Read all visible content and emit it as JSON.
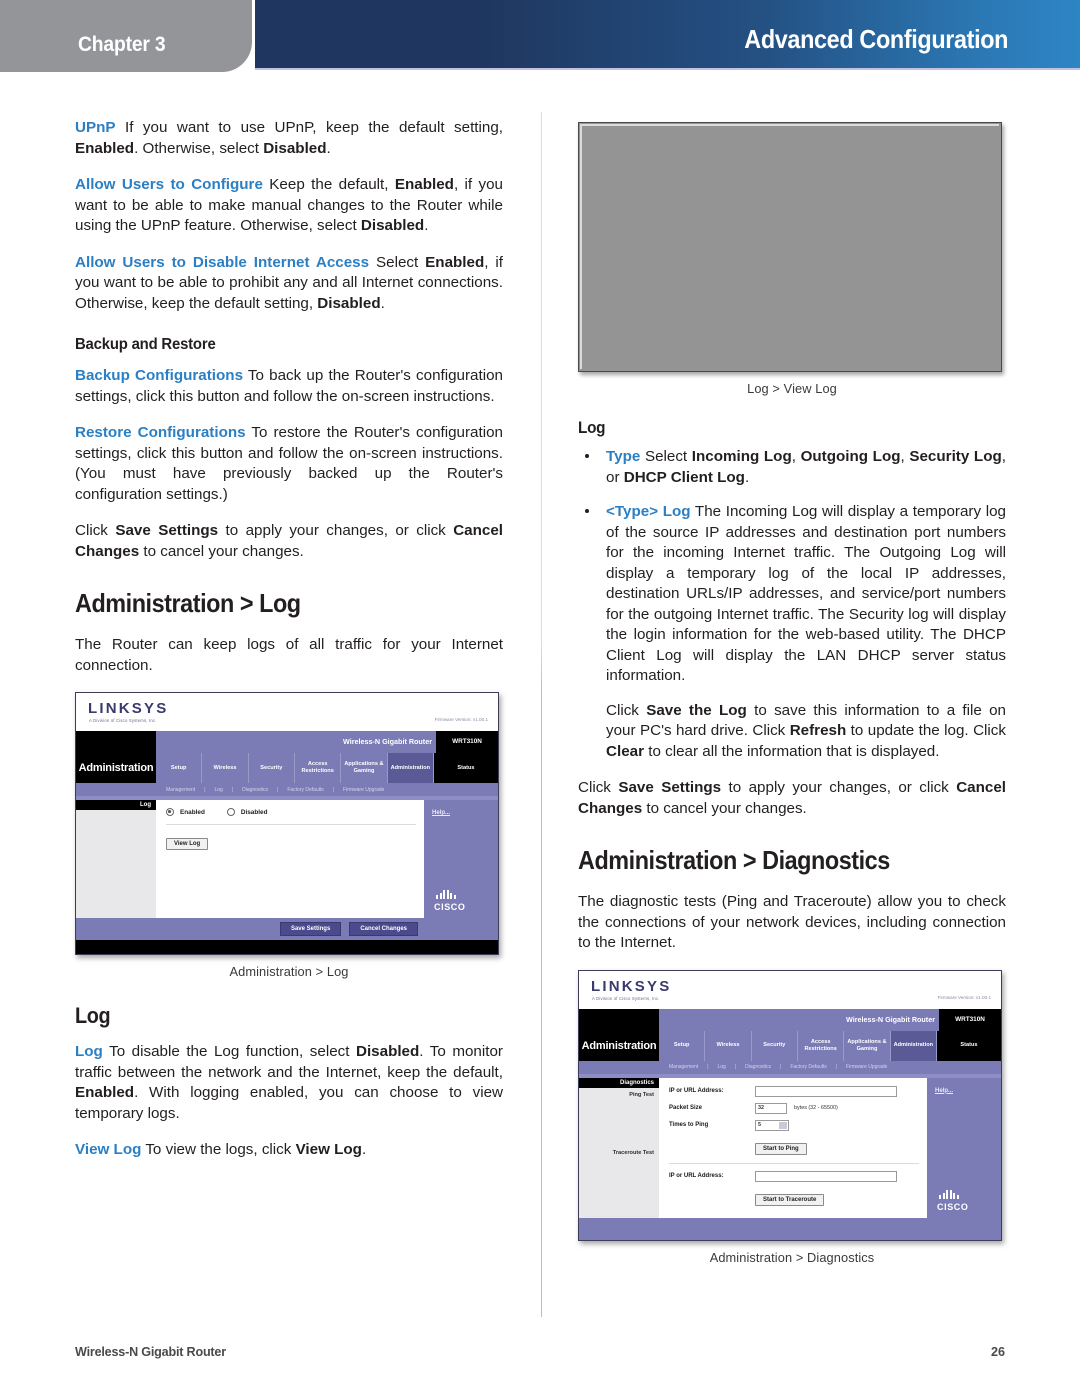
{
  "header": {
    "chapter_label": "Chapter 3",
    "title": "Advanced Configuration"
  },
  "left_column": {
    "upnp": {
      "term": "UPnP",
      "text_1": " If you want to use UPnP, keep the default setting, ",
      "bold_1": "Enabled",
      "text_2": ". Otherwise, select ",
      "bold_2": "Disabled",
      "text_3": "."
    },
    "allow_users_configure": {
      "term": "Allow Users to Configure",
      "text_1": " Keep the default, ",
      "bold_1": "Enabled",
      "text_2": ", if you want to be able to make manual changes to the Router while using the UPnP feature. Otherwise, select ",
      "bold_2": "Disabled",
      "text_3": "."
    },
    "allow_users_disable": {
      "term": "Allow Users to Disable Internet Access",
      "text_1": " Select ",
      "bold_1": "Enabled",
      "text_2": ", if you want to be able to prohibit any and all Internet connections. Otherwise, keep the default setting, ",
      "bold_2": "Disabled",
      "text_3": "."
    },
    "backup_restore_heading": "Backup and Restore",
    "backup_configurations": {
      "term": "Backup Configurations",
      "text": " To back up the Router's configuration settings, click this button and follow the on-screen instructions."
    },
    "restore_configurations": {
      "term": "Restore Configurations",
      "text": " To restore the Router's configuration settings, click this button and follow the on-screen instructions. (You must have previously backed up the Router's configuration settings.)"
    },
    "save_cancel": {
      "text_1": "Click ",
      "bold_1": "Save Settings",
      "text_2": " to apply your changes, or click ",
      "bold_2": "Cancel Changes",
      "text_3": " to cancel your changes."
    },
    "admin_log_heading": "Administration > Log",
    "admin_log_intro": "The Router can keep logs of all traffic for your Internet connection.",
    "figure_log_caption": "Administration > Log",
    "log_heading": "Log",
    "log_item": {
      "term": "Log",
      "text_1": " To disable the Log function, select ",
      "bold_1": "Disabled",
      "text_2": ". To monitor traffic between the network and the Internet, keep the default, ",
      "bold_2": "Enabled",
      "text_3": ". With logging enabled, you can choose to view temporary logs."
    },
    "view_log_item": {
      "term": "View Log",
      "text_1": " To view the logs, click ",
      "bold_1": "View Log",
      "text_2": "."
    }
  },
  "right_column": {
    "figure_viewlog_caption": "Log > View Log",
    "log_heading": "Log",
    "bullet_type": {
      "term": "Type",
      "text_1": " Select ",
      "bold_1": "Incoming Log",
      "text_2": ", ",
      "bold_2": "Outgoing Log",
      "text_3": ", ",
      "bold_3": "Security Log",
      "text_4": ", or ",
      "bold_4": "DHCP Client Log",
      "text_5": "."
    },
    "bullet_typelog": {
      "term": "<Type> Log",
      "text": " The Incoming Log will display a temporary log of the source IP addresses and destination port numbers for the incoming Internet traffic. The Outgoing Log will display a temporary log of the local IP addresses, destination URLs/IP addresses, and service/port numbers for the outgoing Internet traffic. The Security log will display the login information for the web-based utility. The DHCP Client Log will display the LAN DHCP server status information."
    },
    "save_log_para": {
      "text_1": "Click ",
      "bold_1": "Save the Log",
      "text_2": " to save this information to a file on your PC's hard drive. Click ",
      "bold_2": "Refresh",
      "text_3": " to update the log. Click ",
      "bold_3": "Clear",
      "text_4": " to clear all the information that is displayed."
    },
    "save_cancel": {
      "text_1": "Click ",
      "bold_1": "Save Settings",
      "text_2": " to apply your changes, or click ",
      "bold_2": "Cancel Changes",
      "text_3": " to cancel your changes."
    },
    "admin_diag_heading": "Administration > Diagnostics",
    "admin_diag_intro": "The diagnostic tests (Ping and Traceroute) allow you to check the connections of your network devices, including connection to the Internet.",
    "figure_diag_caption": "Administration > Diagnostics"
  },
  "router_ui": {
    "brand": "LINKSYS",
    "brand_sub": "A Division of Cisco Systems, Inc.",
    "firmware": "Firmware Version: v1.00.1",
    "model_name": "Wireless-N Gigabit Router",
    "model_number": "WRT310N",
    "section_title": "Administration",
    "tabs": [
      "Setup",
      "Wireless",
      "Security",
      "Access Restrictions",
      "Applications & Gaming",
      "Administration",
      "Status"
    ],
    "subtabs": [
      "Management",
      "Log",
      "Diagnostics",
      "Factory Defaults",
      "Firmware Upgrade"
    ],
    "help_label": "Help...",
    "cisco_label": "CISCO",
    "save_settings": "Save Settings",
    "cancel_changes": "Cancel Changes",
    "log_panel": {
      "side_label": "Log",
      "radio_enabled": "Enabled",
      "radio_disabled": "Disabled",
      "view_log_button": "View Log"
    },
    "diag_panel": {
      "side_label": "Diagnostics",
      "ping_test_label": "Ping Test",
      "ip_url_label": "IP or URL Address:",
      "packet_size_label": "Packet Size",
      "packet_size_value": "32",
      "packet_size_unit": "bytes (32 - 65500)",
      "times_to_ping_label": "Times to Ping",
      "times_to_ping_value": "5",
      "start_ping_button": "Start to Ping",
      "traceroute_test_label": "Traceroute Test",
      "traceroute_ip_label": "IP or URL Address:",
      "start_traceroute_button": "Start to Traceroute"
    }
  },
  "footer": {
    "document_title": "Wireless-N Gigabit Router",
    "page_number": "26"
  },
  "colors": {
    "header_dark": "#1f3760",
    "header_light": "#2e85c4",
    "chapter_gray": "#949598",
    "term_blue": "#2b7fc4",
    "router_purple": "#7b7bb5",
    "body_text": "#231f20"
  }
}
